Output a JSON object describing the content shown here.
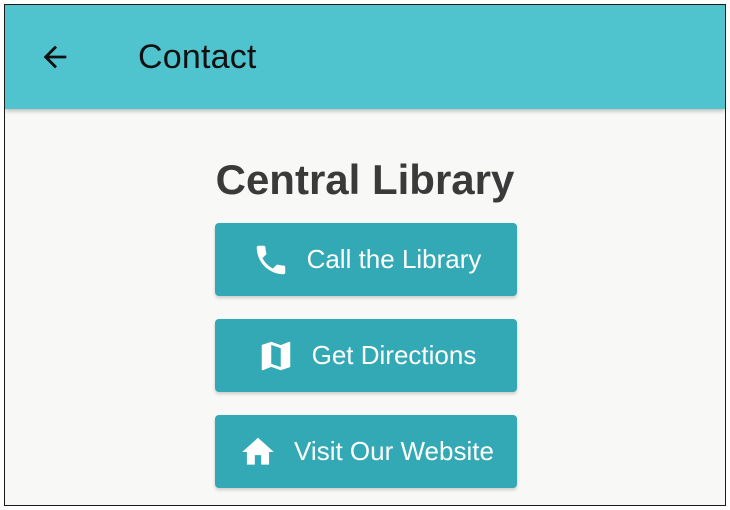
{
  "appbar": {
    "title": "Contact",
    "back_icon": "arrow-left-icon",
    "background_color": "#4fc3ce"
  },
  "main": {
    "title": "Central Library",
    "actions": [
      {
        "label": "Call the Library",
        "icon": "phone-icon"
      },
      {
        "label": "Get Directions",
        "icon": "map-icon"
      },
      {
        "label": "Visit Our Website",
        "icon": "home-icon"
      }
    ],
    "button_color": "#32a9b4"
  }
}
